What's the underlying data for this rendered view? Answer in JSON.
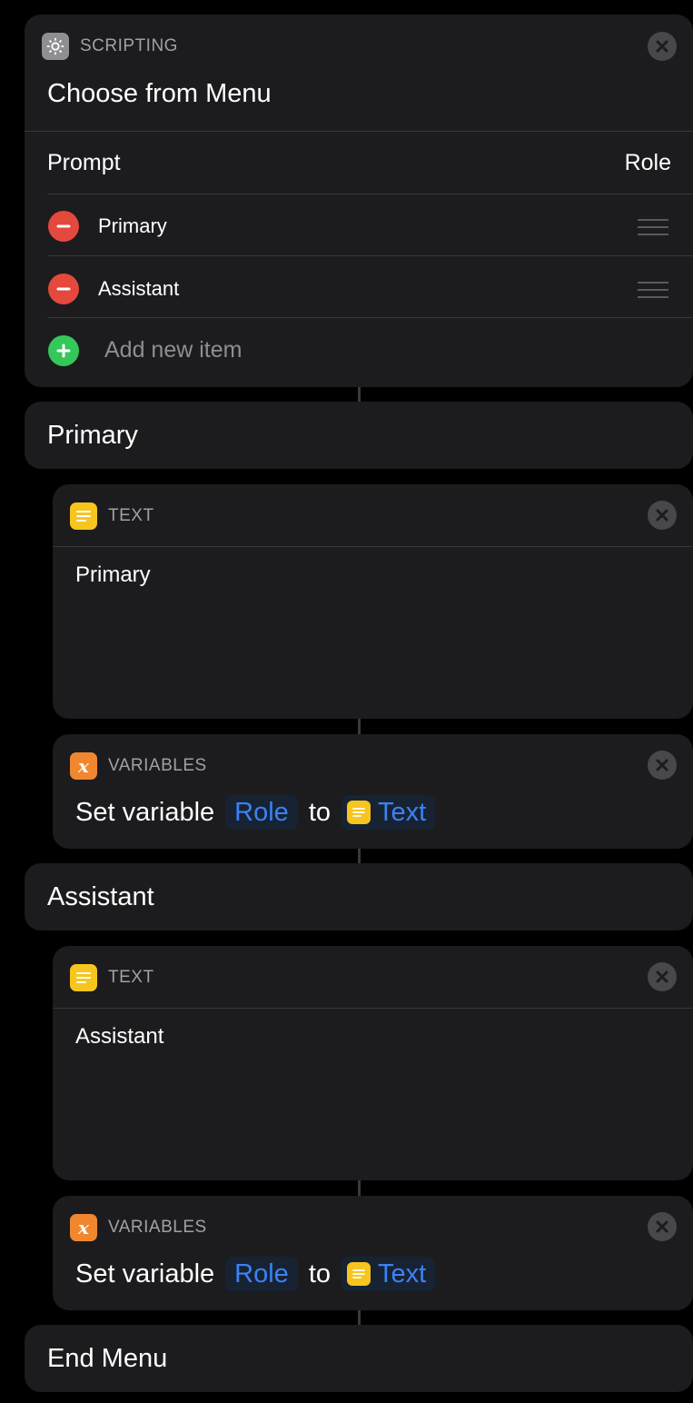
{
  "menu_block": {
    "category": "SCRIPTING",
    "title": "Choose from Menu",
    "prompt_label": "Prompt",
    "prompt_value": "Role",
    "items": [
      {
        "label": "Primary"
      },
      {
        "label": "Assistant"
      }
    ],
    "add_item_label": "Add new item"
  },
  "sections": [
    {
      "header": "Primary",
      "text_action": {
        "category": "TEXT",
        "content": "Primary"
      },
      "variable_action": {
        "category": "VARIABLES",
        "prefix": "Set variable",
        "variable_name": "Role",
        "connector": "to",
        "value_label": "Text"
      }
    },
    {
      "header": "Assistant",
      "text_action": {
        "category": "TEXT",
        "content": "Assistant"
      },
      "variable_action": {
        "category": "VARIABLES",
        "prefix": "Set variable",
        "variable_name": "Role",
        "connector": "to",
        "value_label": "Text"
      }
    }
  ],
  "end_menu": {
    "label": "End Menu"
  },
  "colors": {
    "background": "#000000",
    "card": "#1c1c1e",
    "link_blue": "#3b82f6",
    "remove_red": "#e5483c",
    "add_green": "#34c759",
    "text_icon_yellow": "#f7c51e",
    "variables_icon_orange": "#f0872f",
    "scripting_icon_gray": "#8e8e93"
  },
  "icons": {
    "scripting": "gear-icon",
    "text": "text-lines-icon",
    "variables": "variable-x-icon",
    "close": "close-icon",
    "remove": "minus-icon",
    "add": "plus-icon",
    "reorder": "drag-handle-icon"
  }
}
